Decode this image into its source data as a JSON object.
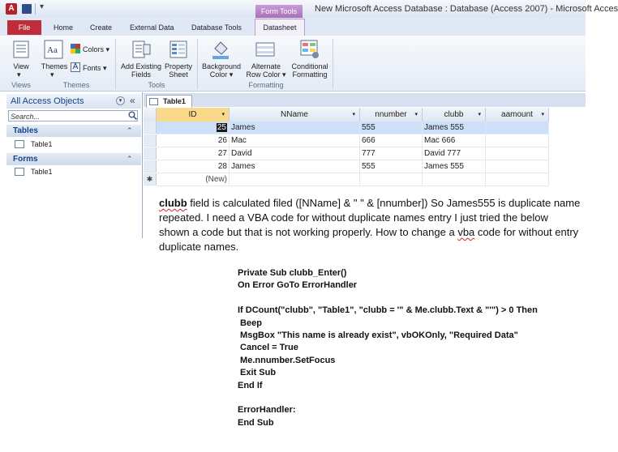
{
  "window": {
    "title": "New Microsoft Access Database : Database (Access 2007)  -  Microsoft Access",
    "context_tab_title": "Form Tools"
  },
  "ribbon": {
    "tabs": [
      "File",
      "Home",
      "Create",
      "External Data",
      "Database Tools",
      "Datasheet"
    ],
    "commands": {
      "view": "View",
      "themes": "Themes",
      "colors": "Colors ▾",
      "fonts": "Fonts ▾",
      "add_existing_fields": [
        "Add Existing",
        "Fields"
      ],
      "property_sheet": [
        "Property",
        "Sheet"
      ],
      "background_color": [
        "Background",
        "Color ▾"
      ],
      "alternate_row_color": [
        "Alternate",
        "Row Color ▾"
      ],
      "conditional_formatting": [
        "Conditional",
        "Formatting"
      ]
    },
    "groups": [
      "Views",
      "Themes",
      "Tools",
      "Formatting"
    ]
  },
  "nav_pane": {
    "header": "All Access Objects",
    "search_placeholder": "Search...",
    "sections": [
      {
        "label": "Tables",
        "items": [
          "Table1"
        ]
      },
      {
        "label": "Forms",
        "items": [
          "Table1"
        ]
      }
    ]
  },
  "datasheet": {
    "tab_label": "Table1",
    "columns": [
      "ID",
      "NName",
      "nnumber",
      "clubb",
      "aamount"
    ],
    "rows": [
      {
        "id": "25",
        "nname": "James",
        "nnumber": "555",
        "clubb": "James 555",
        "aamount": ""
      },
      {
        "id": "26",
        "nname": "Mac",
        "nnumber": "666",
        "clubb": "Mac 666",
        "aamount": ""
      },
      {
        "id": "27",
        "nname": "David",
        "nnumber": "777",
        "clubb": "David 777",
        "aamount": ""
      },
      {
        "id": "28",
        "nname": "James",
        "nnumber": "555",
        "clubb": "James 555",
        "aamount": ""
      }
    ],
    "new_row_label": "(New)",
    "new_row_marker": "✱"
  },
  "question": {
    "p1": "clubb",
    "p2": " field is calculated filed ([NName] & \" \" & [nnumber]) So James555  is duplicate name repeated. I need a  VBA code for without duplicate names entry I just tried the below shown a  code but that is not working properly. How to change a ",
    "p3": "vba",
    "p4": " code for without entry duplicate names."
  },
  "code": [
    "Private Sub clubb_Enter()",
    "On Error GoTo ErrorHandler",
    "",
    "If DCount(\"clubb\", \"Table1\", \"clubb = '\" & Me.clubb.Text & \"'\") > 0 Then",
    " Beep",
    " MsgBox \"This name is already exist\", vbOKOnly, \"Required Data\"",
    " Cancel = True",
    " Me.nnumber.SetFocus",
    " Exit Sub",
    "End If",
    "",
    "ErrorHandler:",
    "End Sub"
  ]
}
